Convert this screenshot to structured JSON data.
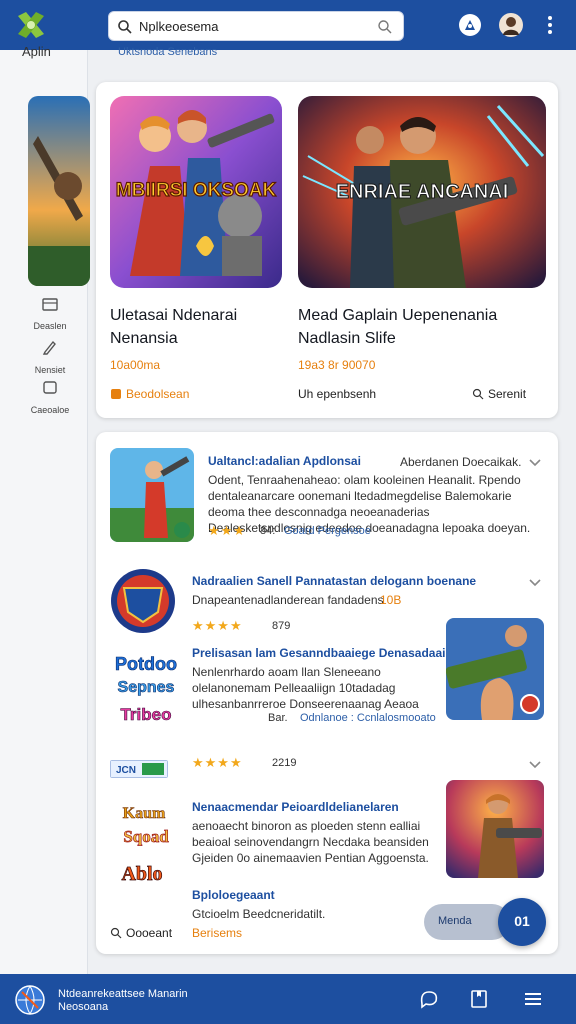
{
  "search": {
    "query": "Nplkeoesema"
  },
  "rail": {
    "title": "Aplin",
    "items": [
      {
        "label": "Deaslen"
      },
      {
        "label": "Nensiet"
      },
      {
        "label": "Caeoaloe"
      }
    ]
  },
  "header_sub": "Uktsnoda Senebans",
  "featured": [
    {
      "art_text": "MBIIRSI OKSOAK",
      "title_line1": "Uletasai Ndenarai",
      "title_line2": "Nenansia",
      "meta": "10a00ma",
      "foot": "Beodolsean"
    },
    {
      "art_text": "ENRIAE ANCANAI",
      "title_line1": "Mead Gaplain Uepenenania",
      "title_line2": "Nadlasin Slife",
      "meta": "19a3 8r 90070",
      "foot_left": "Uh epenbsenh",
      "foot_right": "Serenit"
    }
  ],
  "list": [
    {
      "title": "Ualtancl:adalian Apdlonsai",
      "title_tail": "Aberdanen Doecaikak.",
      "desc": "Odent, Tenraahenaheao: olam kooleinen Heanalit. Rpendo dentaleanarcare oonemani ltedadmegdelise Balemokarie deoma thee desconnadga neoeanaderias Dealesketsndlosnig edeedoe doeanadagna lepoaka doeyan.",
      "rating": "84:",
      "link": "Goard Pergensoe"
    },
    {
      "title": "Nadraalien Sanell Pannatastan delogann boenane",
      "desc": "Dnapeantenadlanderean fandadens",
      "desc_tail": "10B",
      "rating": "879"
    },
    {
      "title": "Prelisasan lam Gesanndbaaiege Denasadaai",
      "desc": "Nenlenrhardo aoam llan Sleneeano olelanonemam Pelleaaliign 10tadadag ulhesanbanrreroe Donseerenaanag Aeaoa",
      "link_left": "Bar.",
      "link": "Odnlanoe : Ccnlalosmooato",
      "logo_text1": "Potdoo",
      "logo_text2": "Sepnes",
      "logo_text3": "Tribeo"
    },
    {
      "badge": "JCN",
      "rating": "2219",
      "title": "Nenaacmendar Peioardldelianelaren",
      "desc": "aenoaecht binoron as ploeden stenn ealliai beaioal seinovendangrn Necdaka beansiden Gjeiden 0o ainemaavien Pentian Aggoensta.",
      "sub_title": "Bploloegeaant",
      "sub_desc": "Gtcioelm Beedcneridatilt."
    }
  ],
  "card_footer": {
    "left": "Oooeant",
    "right": "Berisems"
  },
  "toggle_label": "Menda",
  "fab_label": "01",
  "bottom": {
    "line1": "Ntdeanrekeattsee Manarin",
    "line2": "Neosoana"
  },
  "colors": {
    "primary": "#1d4fa0",
    "accent": "#e6800f",
    "star": "#f2a81c"
  }
}
